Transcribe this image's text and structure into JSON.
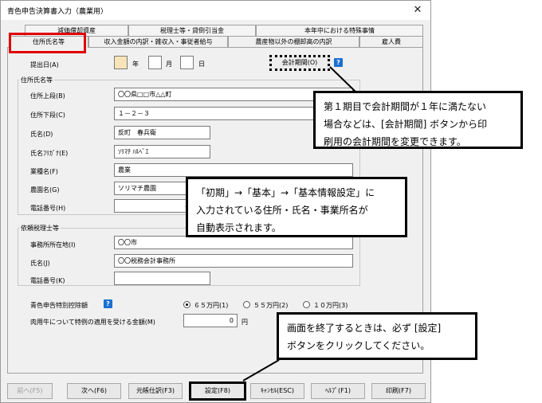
{
  "window": {
    "title": "青色申告決算書入力（農業用）",
    "close": "✕"
  },
  "tabs": {
    "row1": [
      "減価償却資産",
      "税理士等・貸倒引当金",
      "本年中における特殊事情"
    ],
    "row2": [
      "住所氏名等",
      "収入金額の内訳・雑収入・事従者給与",
      "農産物以外の棚卸高の内訳",
      "雇人費"
    ]
  },
  "submission": {
    "label": "提出日(A)",
    "year_unit": "年",
    "month_unit": "月",
    "day_unit": "日",
    "accounting_button": "会計期間(O)",
    "help": "?"
  },
  "address_group": {
    "title": "住所氏名等",
    "rows": [
      {
        "label": "住所上段(B)",
        "value": "〇〇県□□市△△町"
      },
      {
        "label": "住所下段(C)",
        "value": "１－２－３"
      },
      {
        "label": "氏名(D)",
        "value": "反町　春兵衛"
      },
      {
        "label": "氏名ﾌﾘｶﾞﾅ(E)",
        "value": "ｿﾘﾏﾁ ﾊﾙﾍﾞｴ"
      },
      {
        "label": "業種名(F)",
        "value": "農業"
      },
      {
        "label": "農園名(G)",
        "value": "ソリマチ農園"
      },
      {
        "label": "電話番号(H)",
        "value": ""
      }
    ]
  },
  "tax_group": {
    "title": "依頼税理士等",
    "rows": [
      {
        "label": "事務所所在地(I)",
        "value": "〇〇市"
      },
      {
        "label": "氏名(J)",
        "value": "〇〇税務会計事務所"
      },
      {
        "label": "電話番号(K)",
        "value": ""
      }
    ]
  },
  "deduction": {
    "label": "青色申告特別控除額",
    "help": "?",
    "options": [
      "６５万円(1)",
      "５５万円(2)",
      "１０万円(3)"
    ],
    "selected_index": 0
  },
  "beef": {
    "label": "肉用牛について特例の適用を受ける金額(M)",
    "value": "0",
    "unit": "円"
  },
  "buttons": [
    "前へ(F5)",
    "次へ(F6)",
    "元帳仕訳(F3)",
    "設定(F8)",
    "ｷｬﾝｾﾙ(ESC)",
    "ﾍﾙﾌﾟ(F1)",
    "印刷(F7)"
  ],
  "callouts": {
    "accounting": [
      "第１期目で会計期間が１年に満たない",
      "場合などは、[会計期間] ボタンから印",
      "刷用の会計期間を変更できます。"
    ],
    "auto": [
      "「初期」→「基本」→「基本情報設定」に",
      "入力されている住所・氏名・事業所名が",
      "自動表示されます。"
    ],
    "settings": [
      "画面を終了するときは、必ず [設定]",
      "ボタンをクリックしてください。"
    ]
  },
  "colors": {
    "highlight_red": "#e00000",
    "date_year_fill": "#f8e4b8",
    "help_blue": "#1a6fd1"
  }
}
